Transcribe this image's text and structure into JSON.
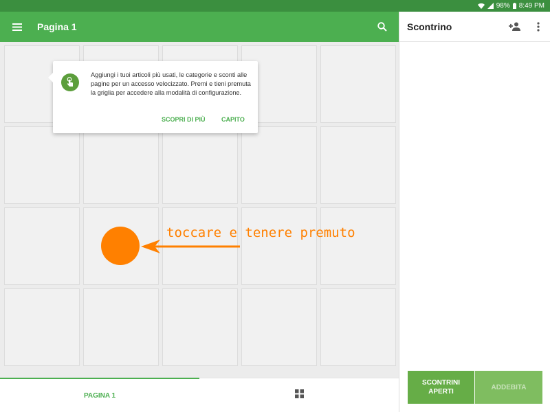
{
  "status_bar": {
    "battery": "98%",
    "time": "8:49 PM"
  },
  "app_bar": {
    "title": "Pagina 1"
  },
  "receipt_panel": {
    "title": "Scontrino"
  },
  "popup": {
    "text": "Aggiungi i tuoi articoli più usati, le categorie e sconti alle pagine per un accesso velocizzato. Premi e tieni premuta la griglia per accedere alla modalità di configurazione.",
    "learn_more_label": "SCOPRI DI PIÙ",
    "got_it_label": "CAPITO"
  },
  "annotation": {
    "text": "toccare e tenere premuto",
    "color": "#ff8000"
  },
  "bottom_tabs": {
    "page_label": "PAGINA 1"
  },
  "actions": {
    "open_receipts_label": "SCONTRINI APERTI",
    "charge_label": "ADDEBITA"
  },
  "colors": {
    "primary": "#4caf50",
    "status_bar": "#3b8f3f",
    "accent_orange": "#ff8000"
  },
  "icons": [
    "menu-icon",
    "search-icon",
    "add-person-icon",
    "more-vert-icon",
    "touch-icon",
    "grid-view-icon",
    "wifi-icon",
    "signal-icon",
    "battery-icon"
  ]
}
